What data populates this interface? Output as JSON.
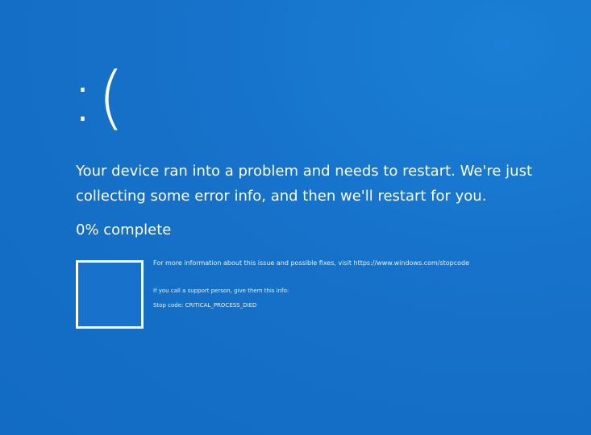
{
  "screen": {
    "emoticon": ":(",
    "message": "Your device ran into a problem and needs to restart. We're just collecting some error info, and then we'll restart for you.",
    "progress_text": "0% complete",
    "progress_value": 0,
    "more_info": "For more information about this issue and possible fixes, visit https://www.windows.com/stopcode",
    "support_text": "If you call a support person, give them this info:",
    "stop_code_text": "Stop code: CRITICAL_PROCESS_DIED"
  },
  "colors": {
    "background": "#1873cc",
    "text": "#ffffff"
  },
  "icons": {
    "qr": "qr-code-icon"
  }
}
